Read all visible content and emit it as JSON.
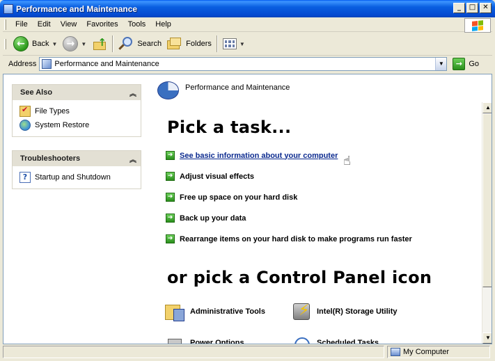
{
  "window": {
    "title": "Performance and Maintenance",
    "controls": {
      "minimize": "_",
      "maximize": "□",
      "close": "✕"
    }
  },
  "menu": {
    "items": [
      "File",
      "Edit",
      "View",
      "Favorites",
      "Tools",
      "Help"
    ]
  },
  "toolbar": {
    "back_label": "Back",
    "search_label": "Search",
    "folders_label": "Folders"
  },
  "address": {
    "label": "Address",
    "value": "Performance and Maintenance",
    "go_label": "Go"
  },
  "see_also": {
    "title": "See Also",
    "items": [
      "File Types",
      "System Restore"
    ]
  },
  "troubleshooters": {
    "title": "Troubleshooters",
    "items": [
      "Startup and Shutdown"
    ]
  },
  "main": {
    "category_title": "Performance and Maintenance",
    "pick_task_heading": "Pick a task...",
    "tasks": [
      "See basic information about your computer",
      "Adjust visual effects",
      "Free up space on your hard disk",
      "Back up your data",
      "Rearrange items on your hard disk to make programs run faster"
    ],
    "pick_icon_heading": "or pick a Control Panel icon",
    "icons": [
      "Administrative Tools",
      "Intel(R) Storage Utility",
      "Power Options",
      "Scheduled Tasks"
    ]
  },
  "status": {
    "zone": "My Computer"
  }
}
